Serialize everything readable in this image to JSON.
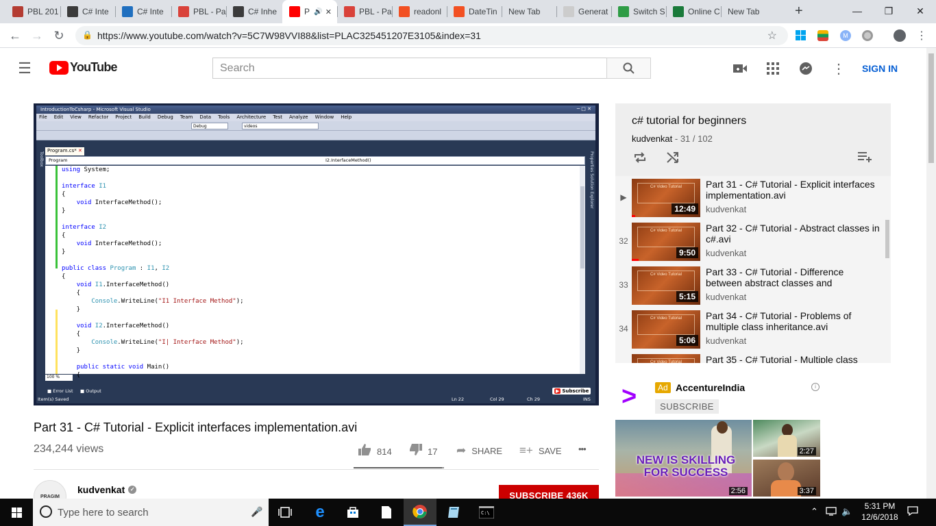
{
  "browser": {
    "tabs": [
      {
        "label": "PBL 201",
        "icon": "pbl-icon",
        "color": "#b43c32"
      },
      {
        "label": "C# Inte",
        "icon": "diamond-icon",
        "color": "#3b3b3b"
      },
      {
        "label": "C# Inte",
        "icon": "t-icon",
        "color": "#1f6fbf"
      },
      {
        "label": "PBL - Pa",
        "icon": "pbl-icon",
        "color": "#d9423a"
      },
      {
        "label": "C# Inhe",
        "icon": "diamond-icon",
        "color": "#3b3b3b"
      },
      {
        "label": "P",
        "icon": "youtube-icon",
        "color": "#ff0000",
        "active": true
      },
      {
        "label": "PBL - Pa",
        "icon": "pbl-icon",
        "color": "#d9423a"
      },
      {
        "label": "readonl",
        "icon": "microsoft-icon",
        "color": "#f25022"
      },
      {
        "label": "DateTin",
        "icon": "microsoft-icon",
        "color": "#f25022"
      },
      {
        "label": "New Tab",
        "icon": "",
        "color": ""
      },
      {
        "label": "Generat",
        "icon": "doc-icon",
        "color": "#cccccc"
      },
      {
        "label": "Switch S",
        "icon": "dg-icon",
        "color": "#2e9c45"
      },
      {
        "label": "Online C",
        "icon": "code-icon",
        "color": "#1a7a3a"
      },
      {
        "label": "New Tab",
        "icon": "",
        "color": ""
      }
    ],
    "new_tab_glyph": "+",
    "url": "https://www.youtube.com/watch?v=5C7W98VVI88&list=PLAC325451207E3105&index=31"
  },
  "youtube": {
    "logo_text": "YouTube",
    "search_placeholder": "Search",
    "sign_in": "SIGN IN"
  },
  "video": {
    "title": "Part 31 - C# Tutorial - Explicit interfaces implementation.avi",
    "views": "234,244 views",
    "likes": "814",
    "dislikes": "17",
    "like_ratio": 0.98,
    "share": "SHARE",
    "save": "SAVE",
    "more": "•••",
    "channel": "kudvenkat",
    "channel_avatar_text": "PRAGIM",
    "subscribe": "SUBSCRIBE 436K"
  },
  "screen": {
    "window_title": "IntroductionToCsharp - Microsoft Visual Studio",
    "menu": [
      "File",
      "Edit",
      "View",
      "Refactor",
      "Project",
      "Build",
      "Debug",
      "Team",
      "Data",
      "Tools",
      "Architecture",
      "Test",
      "Analyze",
      "Window",
      "Help"
    ],
    "config_combo": "Debug",
    "project_combo": "videos",
    "doc_tab": "Program.cs*",
    "nav_left": "Program",
    "nav_right": "I2.InterfaceMethod()",
    "zoom": "100 %",
    "left_strip": "Toolbox",
    "right_strip": "Properties  Solution Explorer",
    "panel_tabs": [
      "Error List",
      "Output"
    ],
    "status": {
      "left": "Item(s) Saved",
      "ln": "Ln 22",
      "col": "Col 29",
      "ch": "Ch 29",
      "mode": "INS"
    },
    "watermark": "Subscribe"
  },
  "playlist": {
    "title": "c# tutorial for beginners",
    "owner": "kudvenkat",
    "position": "31 / 102",
    "thumb_brand": "C# Video Tutorial",
    "items": [
      {
        "index": "▶",
        "title": "Part 31 - C# Tutorial - Explicit interfaces implementation.avi",
        "channel": "kudvenkat",
        "duration": "12:49",
        "watched": 0.05
      },
      {
        "index": "32",
        "title": "Part 32 - C# Tutorial - Abstract classes in c#.avi",
        "channel": "kudvenkat",
        "duration": "9:50",
        "watched": 0.1
      },
      {
        "index": "33",
        "title": "Part 33 - C# Tutorial - Difference between abstract classes and",
        "channel": "kudvenkat",
        "duration": "5:15",
        "watched": 0
      },
      {
        "index": "34",
        "title": "Part 34 - C# Tutorial - Problems of multiple class inheritance.avi",
        "channel": "kudvenkat",
        "duration": "5:06",
        "watched": 0
      },
      {
        "index": "",
        "title": "Part 35 - C# Tutorial - Multiple class",
        "channel": "kudvenkat",
        "duration": "",
        "watched": 0
      }
    ]
  },
  "ad": {
    "badge": "Ad",
    "advertiser": "AccentureIndia",
    "subscribe": "SUBSCRIBE",
    "headline": "NEW IS SKILLING FOR SUCCESS",
    "durations": [
      "2:56",
      "2:27",
      "3:37"
    ]
  },
  "taskbar": {
    "search_placeholder": "Type here to search",
    "time": "5:31 PM",
    "date": "12/6/2018"
  }
}
